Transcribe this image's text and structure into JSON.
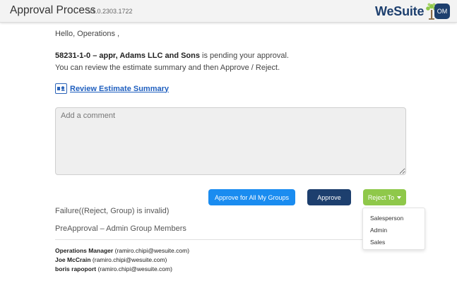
{
  "header": {
    "title": "Approval Process",
    "version": "V1.0.2303.1722",
    "brand": "WeSuite",
    "user_initials": "OM"
  },
  "message": {
    "greeting": "Hello, Operations ,",
    "estimate_bold": "58231-1-0 – appr, Adams LLC and Sons",
    "pending_suffix": " is pending your approval.",
    "review_text": "You can review the estimate summary and then Approve / Reject."
  },
  "review_link": {
    "label": "Review Estimate Summary",
    "icon": "estimate-summary-icon"
  },
  "comment": {
    "placeholder": "Add a comment",
    "value": ""
  },
  "actions": {
    "approve_all": "Approve for All My Groups",
    "approve": "Approve",
    "reject_to": "Reject To"
  },
  "reject_menu": [
    "Salesperson",
    "Admin",
    "Sales"
  ],
  "error_text": "Failure((Reject, Group) is invalid)",
  "group": {
    "title": "PreApproval – Admin Group Members",
    "members": [
      {
        "name": "Operations Manager",
        "email": "(ramiro.chipi@wesuite.com)"
      },
      {
        "name": "Joe McCrain",
        "email": "(ramiro.chipi@wesuite.com)"
      },
      {
        "name": "boris rapoport",
        "email": "(ramiro.chipi@wesuite.com)"
      }
    ]
  },
  "colors": {
    "primary_blue": "#1a8cf0",
    "navy": "#1d3f6e",
    "green": "#8fc84a",
    "link": "#1f5fbf"
  }
}
